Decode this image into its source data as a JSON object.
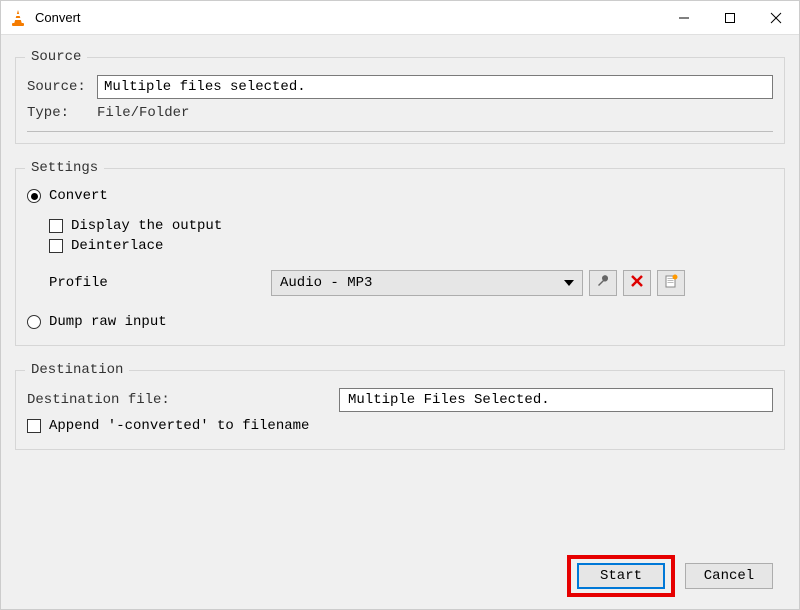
{
  "window": {
    "title": "Convert"
  },
  "source": {
    "legend": "Source",
    "source_label": "Source:",
    "source_value": "Multiple files selected.",
    "type_label": "Type:",
    "type_value": "File/Folder"
  },
  "settings": {
    "legend": "Settings",
    "convert_label": "Convert",
    "display_output_label": "Display the output",
    "deinterlace_label": "Deinterlace",
    "profile_label": "Profile",
    "profile_value": "Audio - MP3",
    "dump_raw_label": "Dump raw input"
  },
  "destination": {
    "legend": "Destination",
    "dest_file_label": "Destination file:",
    "dest_file_value": "Multiple Files Selected.",
    "append_label": "Append '-converted' to filename"
  },
  "footer": {
    "start_label": "Start",
    "cancel_label": "Cancel"
  }
}
